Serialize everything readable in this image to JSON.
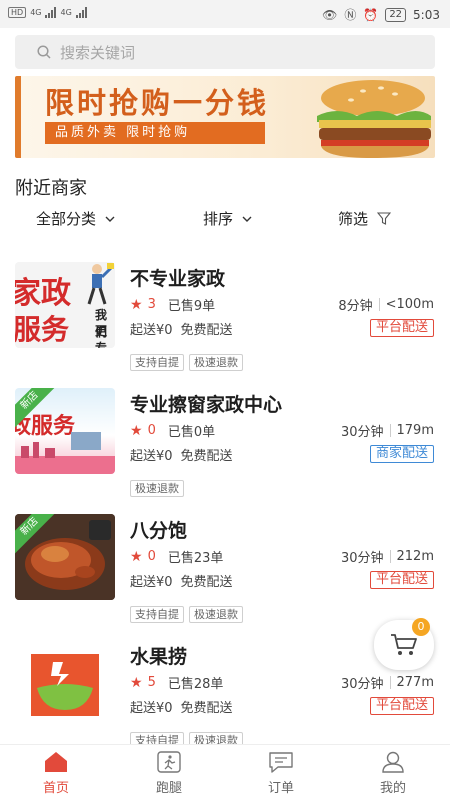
{
  "status_bar": {
    "hd": "HD",
    "sig1": "4G",
    "sig2": "4G",
    "battery": "22",
    "time": "5:03"
  },
  "search": {
    "placeholder": "搜索关键词"
  },
  "banner": {
    "title": "限时抢购一分钱",
    "subtitle": "品质外卖  限时抢购"
  },
  "section_title": "附近商家",
  "filters": {
    "category": "全部分类",
    "sort": "排序",
    "filter": "筛选"
  },
  "shops": [
    {
      "name": "不专业家政",
      "rating": "3",
      "sold": "已售9单",
      "time": "8分钟",
      "distance": "<100m",
      "min_order": "起送¥0",
      "delivery_fee": "免费配送",
      "delivery_type": "平台配送",
      "tags": [
        "支持自提",
        "极速退款"
      ],
      "new_label": "",
      "thumb_text1": "家政",
      "thumb_text2": "服务",
      "thumb_text3": "我们",
      "thumb_text4": "更专"
    },
    {
      "name": "专业擦窗家政中心",
      "rating": "0",
      "sold": "已售0单",
      "time": "30分钟",
      "distance": "179m",
      "min_order": "起送¥0",
      "delivery_fee": "免费配送",
      "delivery_type": "商家配送",
      "tags": [
        "极速退款"
      ],
      "new_label": "新店",
      "thumb_text1": "政服务"
    },
    {
      "name": "八分饱",
      "rating": "0",
      "sold": "已售23单",
      "time": "30分钟",
      "distance": "212m",
      "min_order": "起送¥0",
      "delivery_fee": "免费配送",
      "delivery_type": "平台配送",
      "tags": [
        "支持自提",
        "极速退款"
      ],
      "new_label": "新店"
    },
    {
      "name": "水果捞",
      "rating": "5",
      "sold": "已售28单",
      "time": "30分钟",
      "distance": "277m",
      "min_order": "起送¥0",
      "delivery_fee": "免费配送",
      "delivery_type": "平台配送",
      "tags": [
        "支持自提",
        "极速退款"
      ],
      "new_label": ""
    }
  ],
  "cart": {
    "count": "0"
  },
  "tabbar": [
    {
      "label": "首页",
      "icon": "home-icon",
      "active": true
    },
    {
      "label": "跑腿",
      "icon": "errand-icon",
      "active": false
    },
    {
      "label": "订单",
      "icon": "order-icon",
      "active": false
    },
    {
      "label": "我的",
      "icon": "profile-icon",
      "active": false
    }
  ],
  "colors": {
    "accent": "#e24a3b",
    "platform": "#e24a3b",
    "merchant": "#3f8ad6",
    "new_tag": "#49b14a",
    "banner": "#d35f1c"
  }
}
